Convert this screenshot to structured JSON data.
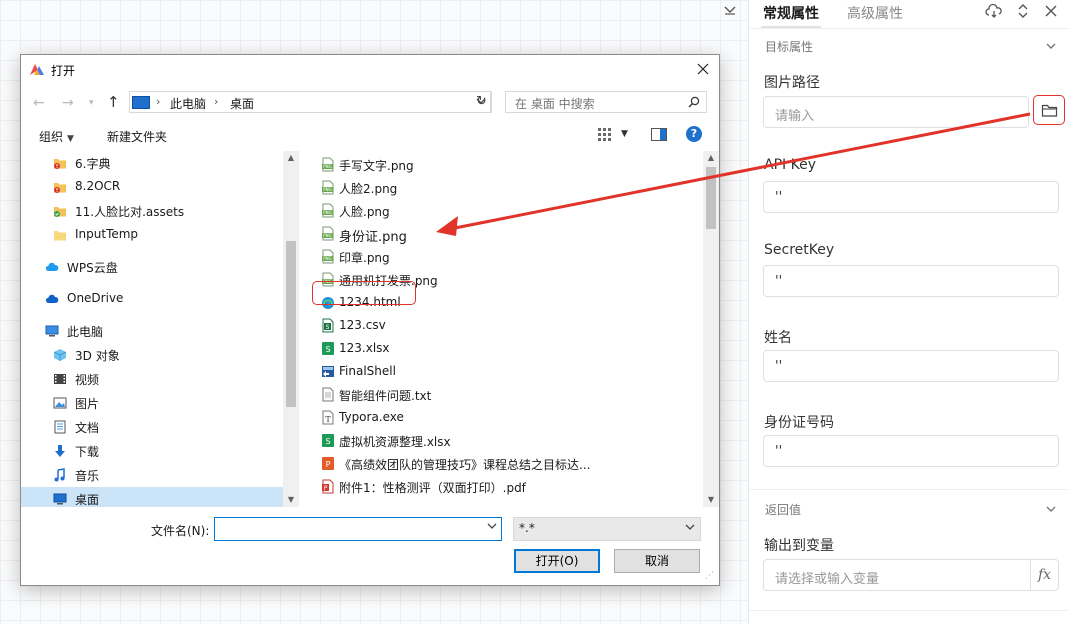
{
  "panel": {
    "tabs": [
      "常规属性",
      "高级属性"
    ],
    "sections": {
      "target": "目标属性",
      "return": "返回值"
    },
    "fields": [
      {
        "label": "图片路径",
        "placeholder": "请输入",
        "value": ""
      },
      {
        "label": "API Key",
        "value": "''"
      },
      {
        "label": "SecretKey",
        "value": "''"
      },
      {
        "label": "姓名",
        "value": "''"
      },
      {
        "label": "身份证号码",
        "value": "''"
      }
    ],
    "output": {
      "label": "输出到变量",
      "placeholder": "请选择或输入变量",
      "fx": "fx"
    }
  },
  "dialog": {
    "title": "打开",
    "path": [
      "此电脑",
      "桌面"
    ],
    "search_placeholder": "在 桌面 中搜索",
    "toolbar": {
      "organize": "组织",
      "new_folder": "新建文件夹"
    },
    "nav_items": [
      {
        "label": "6.字典",
        "icon": "folder-error-icon"
      },
      {
        "label": "8.2OCR",
        "icon": "folder-error-icon"
      },
      {
        "label": "11.人脸比对.assets",
        "icon": "folder-synced-icon"
      },
      {
        "label": "InputTemp",
        "icon": "folder-icon"
      },
      {
        "label": "WPS云盘",
        "icon": "cloud-icon"
      },
      {
        "label": "OneDrive",
        "icon": "onedrive-icon"
      },
      {
        "label": "此电脑",
        "icon": "computer-icon"
      },
      {
        "label": "3D 对象",
        "icon": "3d-objects-icon"
      },
      {
        "label": "视频",
        "icon": "video-icon"
      },
      {
        "label": "图片",
        "icon": "pictures-icon"
      },
      {
        "label": "文档",
        "icon": "documents-icon"
      },
      {
        "label": "下载",
        "icon": "download-icon"
      },
      {
        "label": "音乐",
        "icon": "music-icon"
      },
      {
        "label": "桌面",
        "icon": "desktop-icon"
      }
    ],
    "files": [
      {
        "name": "手写文字.png",
        "icon": "png-icon"
      },
      {
        "name": "人脸2.png",
        "icon": "png-icon"
      },
      {
        "name": "人脸.png",
        "icon": "png-icon"
      },
      {
        "name": "身份证.png",
        "icon": "png-icon"
      },
      {
        "name": "印章.png",
        "icon": "png-icon"
      },
      {
        "name": "通用机打发票.png",
        "icon": "png-icon"
      },
      {
        "name": "1234.html",
        "icon": "edge-icon"
      },
      {
        "name": "123.csv",
        "icon": "csv-icon"
      },
      {
        "name": "123.xlsx",
        "icon": "xlsx-icon"
      },
      {
        "name": "FinalShell",
        "icon": "shortcut-icon"
      },
      {
        "name": "智能组件问题.txt",
        "icon": "txt-icon"
      },
      {
        "name": "Typora.exe",
        "icon": "exe-icon"
      },
      {
        "name": "虚拟机资源整理.xlsx",
        "icon": "xlsx-icon"
      },
      {
        "name": "《高绩效团队的管理技巧》课程总结之目标达...",
        "icon": "ppt-icon"
      },
      {
        "name": "附件1：性格测评（双面打印）.pdf",
        "icon": "pdf-icon"
      }
    ],
    "filename_label": "文件名(N):",
    "filename_value": "",
    "filetype": "*.*",
    "open_button": "打开(O)",
    "cancel_button": "取消"
  },
  "colors": {
    "accent": "#0078d7",
    "highlight_red": "#e2332a",
    "selected_nav": "#cce4f7"
  }
}
